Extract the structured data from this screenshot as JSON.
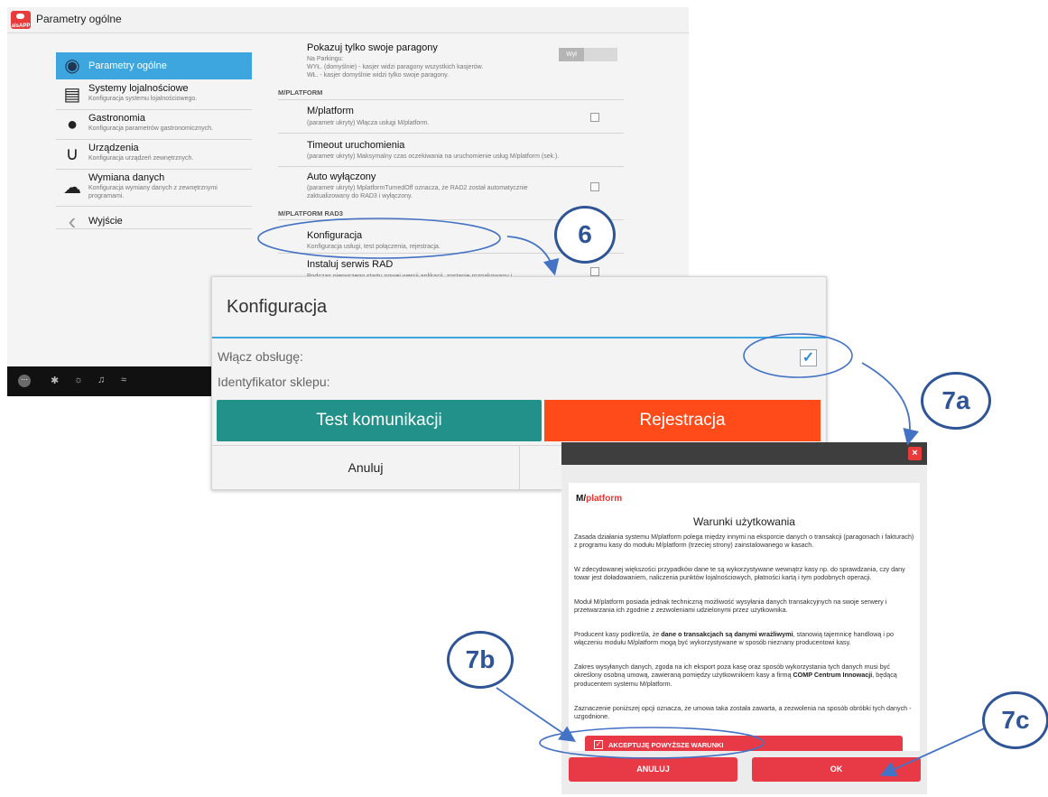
{
  "window": {
    "title": "Parametry ogólne",
    "logo_text": "aisAPP"
  },
  "sidebar": {
    "items": [
      {
        "title": "Parametry ogólne",
        "subtitle": "",
        "icon": "globe-icon"
      },
      {
        "title": "Systemy lojalnościowe",
        "subtitle": "Konfiguracja systemu lojalnościowego.",
        "icon": "loyalty-cards-icon"
      },
      {
        "title": "Gastronomia",
        "subtitle": "Konfiguracja parametrów gastronomicznych.",
        "icon": "chef-hat-icon"
      },
      {
        "title": "Urządzenia",
        "subtitle": "Konfiguracja urządzeń zewnętrznych.",
        "icon": "usb-plug-icon"
      },
      {
        "title": "Wymiana danych",
        "subtitle_line1": "Konfiguracja wymiany danych z zewnętrznymi",
        "subtitle_line2": "programami.",
        "icon": "cloud-icon"
      },
      {
        "title": "Wyjście",
        "subtitle": "",
        "icon": "back-arrow-icon"
      }
    ]
  },
  "settings": {
    "paragony": {
      "title": "Pokazuj tylko swoje paragony",
      "desc1": "Na Parkingu:",
      "desc2": "WYŁ. (domyślnie) - kasjer widzi paragony wszystkich kasjerów.",
      "desc3": "WŁ. - kasjer domyślnie widzi tylko swoje paragony.",
      "toggle": "Wył"
    },
    "section_mplatform": "M/PLATFORM",
    "mplatform": {
      "title": "M/platform",
      "desc": "(parametr ukryty) Włącza usługi M/platform."
    },
    "timeout": {
      "title": "Timeout uruchomienia",
      "desc": "(parametr ukryty) Maksymalny czas oczekiwania na uruchomienie usług M/platform (sek.)."
    },
    "auto": {
      "title": "Auto wyłączony",
      "desc1": "(parametr ukryty) MplatformTurnedOff oznacza, że RAD2 został automatycznie",
      "desc2": "zaktualizowany do RAD3 i wyłączony."
    },
    "section_rad3": "M/PLATFORM RAD3",
    "konfiguracja": {
      "title": "Konfiguracja",
      "desc": "Konfiguracja usługi, test połączenia, rejestracja."
    },
    "instaluj": {
      "title": "Instaluj serwis RAD",
      "desc": "Podczas pierwszego startu nowej wersji aplikacji, zostanie rozpakowany i..."
    }
  },
  "dialog_konfiguracja": {
    "title": "Konfiguracja",
    "enable_label": "Włącz obsługę:",
    "enable_checked": true,
    "shop_id_label": "Identyfikator sklepu:",
    "test_button": "Test komunikacji",
    "register_button": "Rejestracja",
    "cancel_button": "Anuluj",
    "colors": {
      "test": "#21918a",
      "register": "#ff4a1a",
      "accent": "#3ea6df"
    }
  },
  "dialog_terms": {
    "close_symbol": "×",
    "logo_prefix": "M/",
    "logo_suffix": "platform",
    "title": "Warunki użytkowania",
    "p1": "Zasada działania systemu M/platform polega między innymi na eksporcie danych o transakcji (paragonach i fakturach) z programu kasy do modułu M/platform (trzeciej strony) zainstalowanego w kasach.",
    "p2": "W zdecydowanej większości przypadków dane te są wykorzystywane wewnątrz kasy np. do sprawdzania, czy dany towar jest doładowaniem, naliczenia punktów lojalnościowych, płatności kartą i tym podobnych operacji.",
    "p3": "Moduł M/platform posiada jednak techniczną możliwość wysyłania danych transakcyjnych na swoje serwery i przetwarzania ich zgodnie z zezwoleniami udzielonymi przez użytkownika.",
    "p4_a": "Producent kasy podkreśla, że ",
    "p4_b": "dane o transakcjach są danymi wrażliwymi",
    "p4_c": ", stanowią tajemnicę handlową i po włączeniu modułu M/platform mogą być wykorzystywane w sposób nieznany producentowi kasy.",
    "p5_a": "Zakres wysyłanych danych, zgoda na ich eksport poza kasę oraz sposób wykorzystania tych danych musi być określony osobną umową, zawieraną pomiędzy użytkownikiem kasy a firmą ",
    "p5_b": "COMP Centrum Innowacji",
    "p5_c": ", będącą producentem systemu M/platform.",
    "p6": "Zaznaczenie poniższej opcji oznacza, że umowa taka została zawarta, a zezwolenia na sposób obróbki tych danych - uzgodnione.",
    "accept_label": "AKCEPTUJĘ POWYŻSZE WARUNKI",
    "cancel_button": "ANULUJ",
    "ok_button": "OK",
    "colors": {
      "button": "#e83a46"
    }
  },
  "annotations": {
    "b6": "6",
    "b7a": "7a",
    "b7b": "7b",
    "b7c": "7c",
    "color": "#2f5597"
  }
}
